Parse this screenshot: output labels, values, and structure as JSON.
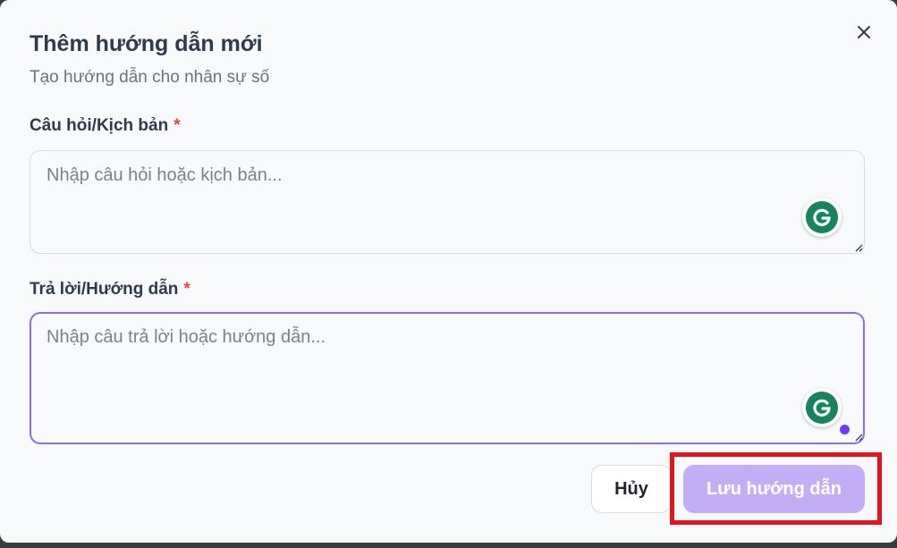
{
  "dialog": {
    "title": "Thêm hướng dẫn mới",
    "subtitle": "Tạo hướng dẫn cho nhân sự số",
    "close_icon": "close-icon"
  },
  "question": {
    "label": "Câu hỏi/Kịch bản",
    "required_mark": "*",
    "placeholder": "Nhập câu hỏi hoặc kịch bản...",
    "value": ""
  },
  "answer": {
    "label": "Trả lời/Hướng dẫn",
    "required_mark": "*",
    "placeholder": "Nhập câu trả lời hoặc hướng dẫn...",
    "value": "",
    "focused": true
  },
  "buttons": {
    "cancel_label": "Hủy",
    "save_label": "Lưu hướng dẫn"
  },
  "colors": {
    "accent": "#8b6cf0",
    "save_button": "#c3aef6",
    "required": "#ef4444",
    "grammarly": "#15845f",
    "highlight": "#e3141b"
  },
  "icons": {
    "grammarly": "grammarly-g-icon",
    "resize": "resize-handle-icon"
  }
}
